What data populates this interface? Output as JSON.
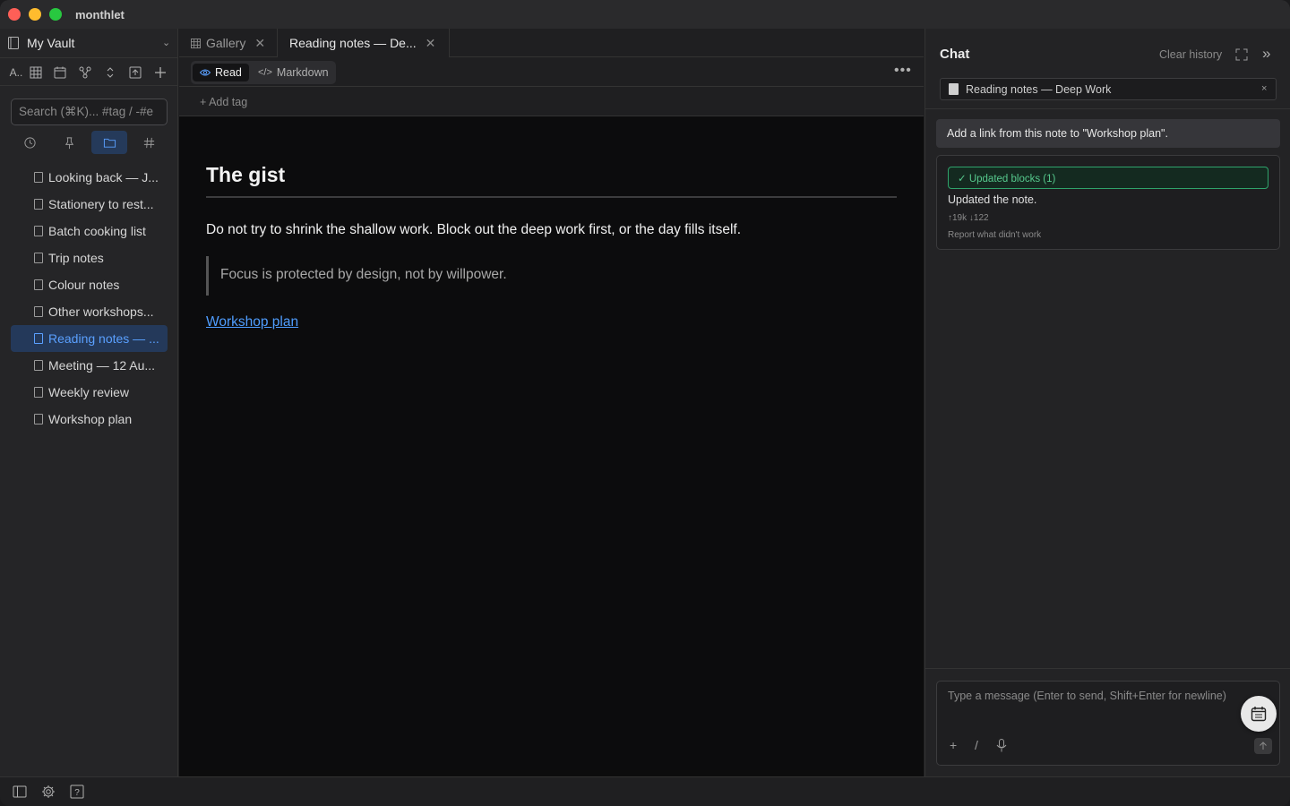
{
  "app": {
    "title": "monthlet"
  },
  "sidebar": {
    "vault_name": "My Vault",
    "toolbar": [
      {
        "name": "sort-alpha-icon",
        "glyph": "A.."
      },
      {
        "name": "grid-view-icon"
      },
      {
        "name": "calendar-icon"
      },
      {
        "name": "graph-icon"
      },
      {
        "name": "expand-collapse-icon"
      },
      {
        "name": "import-icon"
      },
      {
        "name": "add-icon"
      }
    ],
    "search_placeholder": "Search (⌘K)... #tag / -#e",
    "view_tabs": [
      "recent",
      "pinned",
      "folders",
      "tags"
    ],
    "active_view": "folders",
    "notes": [
      {
        "label": "Looking back — J...",
        "active": false
      },
      {
        "label": "Stationery to rest...",
        "active": false
      },
      {
        "label": "Batch cooking list",
        "active": false
      },
      {
        "label": "Trip notes",
        "active": false
      },
      {
        "label": "Colour notes",
        "active": false
      },
      {
        "label": "Other workshops...",
        "active": false
      },
      {
        "label": "Reading notes — ...",
        "active": true
      },
      {
        "label": "Meeting — 12 Au...",
        "active": false
      },
      {
        "label": "Weekly review",
        "active": false
      },
      {
        "label": "Workshop plan",
        "active": false
      }
    ]
  },
  "tabs": [
    {
      "label": "Gallery",
      "active": false
    },
    {
      "label": "Reading notes — De...",
      "active": true
    }
  ],
  "modes": {
    "read": "Read",
    "markdown": "Markdown",
    "active": "read"
  },
  "tagbar": {
    "add_tag": "+ Add tag"
  },
  "document": {
    "heading": "The gist",
    "paragraph": "Do not try to shrink the shallow work. Block out the deep work first, or the day fills itself.",
    "quote": "Focus is protected by design, not by willpower.",
    "link": "Workshop plan"
  },
  "chat": {
    "title": "Chat",
    "clear_history": "Clear history",
    "context_note": "Reading notes — Deep Work",
    "context_close": "×",
    "user_message": "Add a link from this note to \"Workshop plan\".",
    "response": {
      "badge": "✓  Updated blocks (1)",
      "text": "Updated the note.",
      "tokens": "↑19k ↓122",
      "report": "Report what didn't work"
    },
    "composer_placeholder": "Type a message (Enter to send, Shift+Enter for newline)"
  },
  "colors": {
    "accent": "#5aa0ff",
    "link": "#4f9dff",
    "success": "#56c98d"
  }
}
